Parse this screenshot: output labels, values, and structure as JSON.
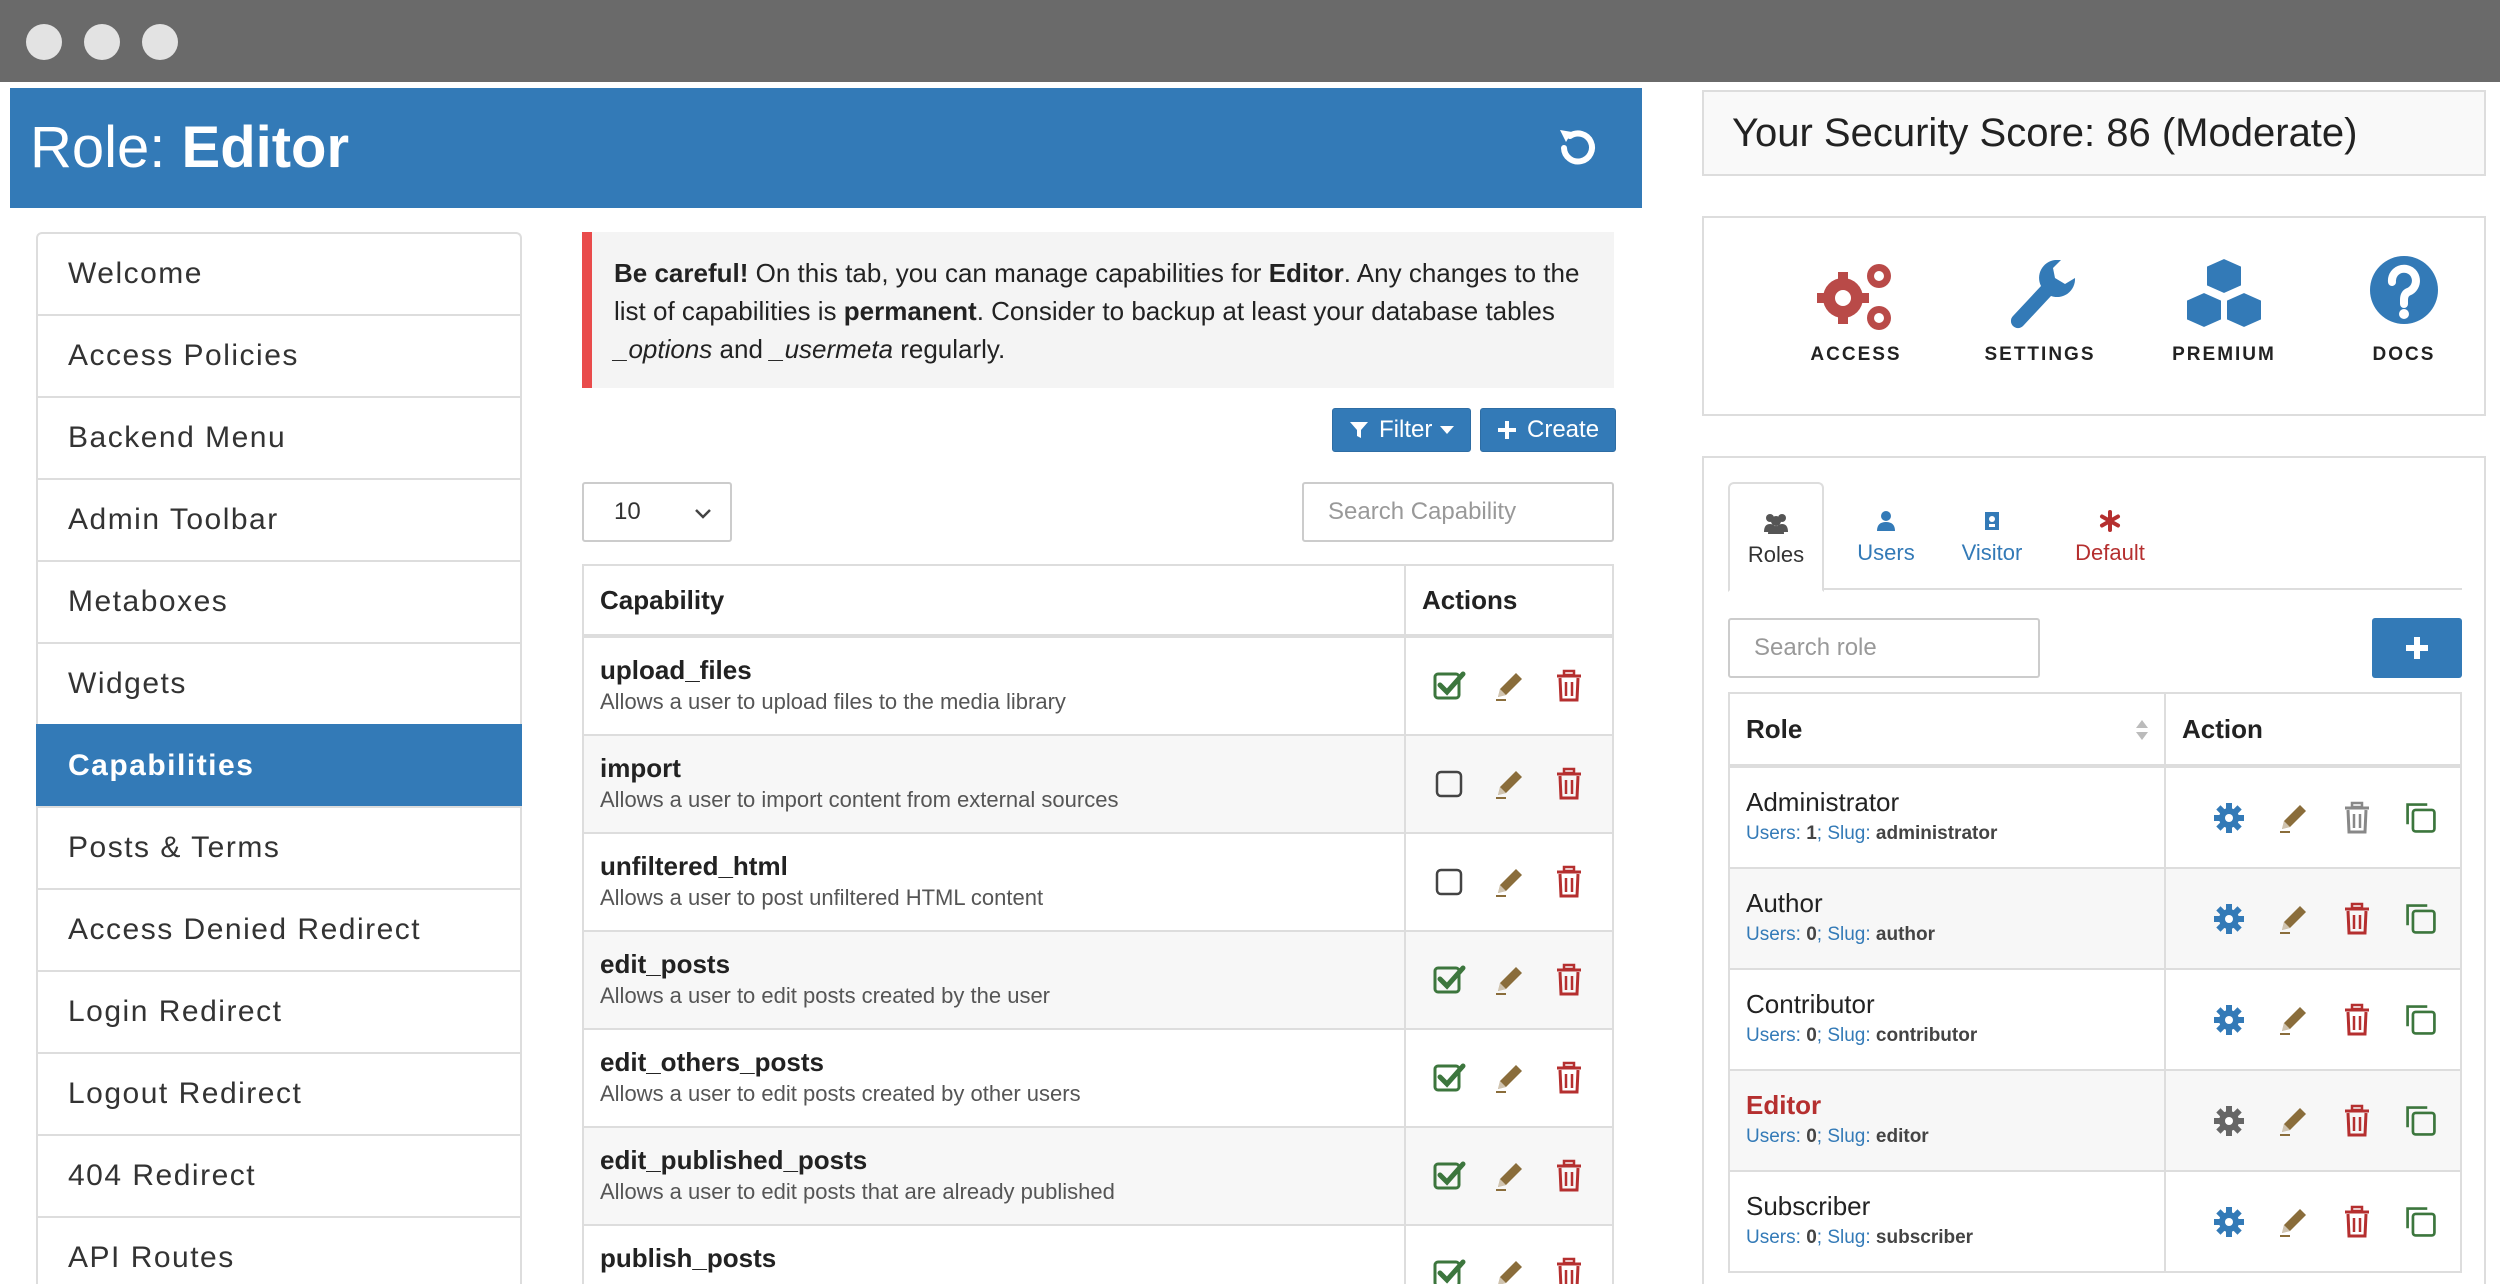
{
  "role_header": {
    "prefix": "Role: ",
    "role_name": "Editor"
  },
  "sidebar": {
    "items": [
      {
        "label": "Welcome"
      },
      {
        "label": "Access Policies"
      },
      {
        "label": "Backend Menu"
      },
      {
        "label": "Admin Toolbar"
      },
      {
        "label": "Metaboxes"
      },
      {
        "label": "Widgets"
      },
      {
        "label": "Capabilities",
        "active": true
      },
      {
        "label": "Posts & Terms"
      },
      {
        "label": "Access Denied Redirect"
      },
      {
        "label": "Login Redirect"
      },
      {
        "label": "Logout Redirect"
      },
      {
        "label": "404 Redirect"
      },
      {
        "label": "API Routes"
      }
    ]
  },
  "alert": {
    "bold_lead": "Be careful!",
    "text_1": " On this tab, you can manage capabilities for ",
    "role": "Editor",
    "text_2": ". Any changes to the list of capabilities is ",
    "permanent": "permanent",
    "text_3": ". Consider to backup at least your database tables ",
    "table_1": "_options",
    "and": " and ",
    "table_2": "_usermeta",
    "text_4": " regularly."
  },
  "toolbar": {
    "filter_label": "Filter",
    "create_label": "Create"
  },
  "page_size": {
    "value": "10"
  },
  "search_capability": {
    "placeholder": "Search Capability"
  },
  "cap_table": {
    "col_capability": "Capability",
    "col_actions": "Actions",
    "rows": [
      {
        "name": "upload_files",
        "desc": "Allows a user to upload files to the media library",
        "checked": true
      },
      {
        "name": "import",
        "desc": "Allows a user to import content from external sources",
        "checked": false
      },
      {
        "name": "unfiltered_html",
        "desc": "Allows a user to post unfiltered HTML content",
        "checked": false
      },
      {
        "name": "edit_posts",
        "desc": "Allows a user to edit posts created by the user",
        "checked": true
      },
      {
        "name": "edit_others_posts",
        "desc": "Allows a user to edit posts created by other users",
        "checked": true
      },
      {
        "name": "edit_published_posts",
        "desc": "Allows a user to edit posts that are already published",
        "checked": true
      },
      {
        "name": "publish_posts",
        "desc": "",
        "checked": true
      }
    ]
  },
  "security_score": {
    "text": "Your Security Score: 86 (Moderate)"
  },
  "quick_links": {
    "access": "ACCESS",
    "settings": "SETTINGS",
    "premium": "PREMIUM",
    "docs": "DOCS"
  },
  "role_tabs": {
    "roles": "Roles",
    "users": "Users",
    "visitor": "Visitor",
    "default": "Default"
  },
  "search_role": {
    "placeholder": "Search role"
  },
  "role_table": {
    "col_role": "Role",
    "col_action": "Action",
    "users_label": "Users:",
    "slug_label": "Slug:",
    "rows": [
      {
        "name": "Administrator",
        "users": "1",
        "slug": "administrator",
        "current": false
      },
      {
        "name": "Author",
        "users": "0",
        "slug": "author",
        "current": false
      },
      {
        "name": "Contributor",
        "users": "0",
        "slug": "contributor",
        "current": false
      },
      {
        "name": "Editor",
        "users": "0",
        "slug": "editor",
        "current": true
      },
      {
        "name": "Subscriber",
        "users": "0",
        "slug": "subscriber",
        "current": false
      }
    ]
  },
  "colors": {
    "primary": "#337ab7",
    "danger": "#b52f2f",
    "success": "#3c763d",
    "edit": "#8a6d3b",
    "alert_border": "#e94b4b",
    "access_icon": "#b94a48"
  }
}
